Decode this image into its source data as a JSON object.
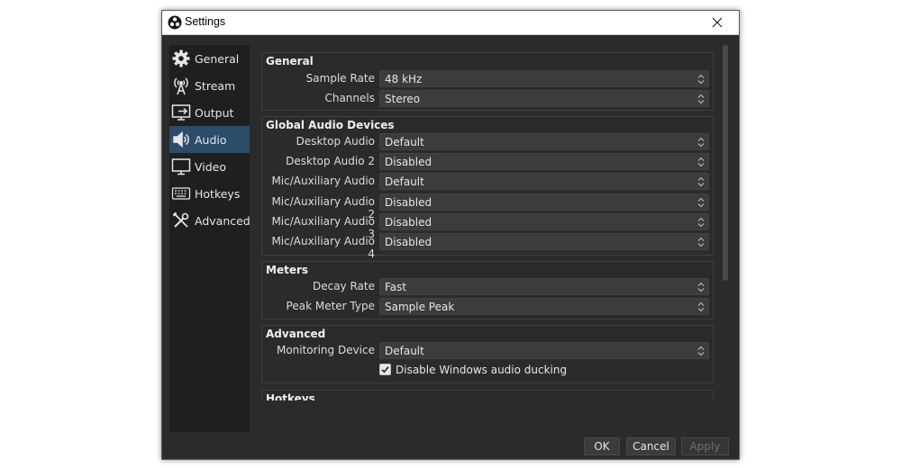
{
  "window": {
    "title": "Settings"
  },
  "sidebar": {
    "items": [
      {
        "label": "General",
        "icon": "gear-icon"
      },
      {
        "label": "Stream",
        "icon": "antenna-icon"
      },
      {
        "label": "Output",
        "icon": "output-icon"
      },
      {
        "label": "Audio",
        "icon": "speaker-icon",
        "active": true
      },
      {
        "label": "Video",
        "icon": "monitor-icon"
      },
      {
        "label": "Hotkeys",
        "icon": "keyboard-icon"
      },
      {
        "label": "Advanced",
        "icon": "tools-icon"
      }
    ]
  },
  "groups": {
    "general": {
      "title": "General",
      "rows": [
        {
          "label": "Sample Rate",
          "value": "48 kHz"
        },
        {
          "label": "Channels",
          "value": "Stereo"
        }
      ]
    },
    "global_audio": {
      "title": "Global Audio Devices",
      "rows": [
        {
          "label": "Desktop Audio",
          "value": "Default"
        },
        {
          "label": "Desktop Audio 2",
          "value": "Disabled"
        },
        {
          "label": "Mic/Auxiliary Audio",
          "value": "Default"
        },
        {
          "label": "Mic/Auxiliary Audio 2",
          "value": "Disabled"
        },
        {
          "label": "Mic/Auxiliary Audio 3",
          "value": "Disabled"
        },
        {
          "label": "Mic/Auxiliary Audio 4",
          "value": "Disabled"
        }
      ]
    },
    "meters": {
      "title": "Meters",
      "rows": [
        {
          "label": "Decay Rate",
          "value": "Fast"
        },
        {
          "label": "Peak Meter Type",
          "value": "Sample Peak"
        }
      ]
    },
    "advanced": {
      "title": "Advanced",
      "rows": [
        {
          "label": "Monitoring Device",
          "value": "Default"
        }
      ],
      "checkbox": {
        "label": "Disable Windows audio ducking",
        "checked": true
      }
    },
    "hotkeys": {
      "title": "Hotkeys"
    }
  },
  "buttons": {
    "ok": "OK",
    "cancel": "Cancel",
    "apply": "Apply"
  },
  "colors": {
    "accent": "#2b4c6a",
    "background": "#2b2b2b",
    "sidebar": "#1f1f1f"
  }
}
